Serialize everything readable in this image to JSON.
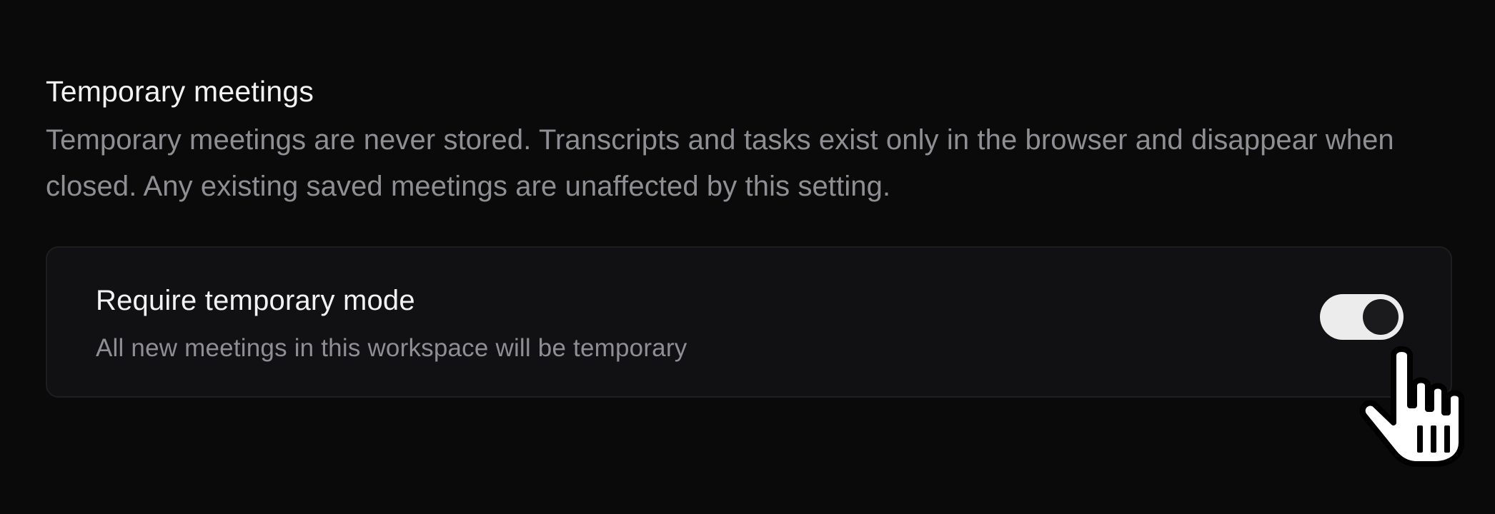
{
  "section": {
    "title": "Temporary meetings",
    "description": "Temporary meetings are never stored. Transcripts and tasks exist only in the browser and disappear when closed. Any existing saved meetings are unaffected by this setting."
  },
  "setting": {
    "label": "Require temporary mode",
    "description": "All new meetings in this workspace will be temporary",
    "enabled": true
  },
  "cursor": {
    "icon": "hand-pointer-icon"
  },
  "colors": {
    "background": "#0a0a0b",
    "card_background": "#111113",
    "text_primary": "#f2f2f3",
    "text_secondary": "#8e8e93",
    "toggle_track_on": "#ececec",
    "toggle_knob": "#1b1b1d"
  }
}
